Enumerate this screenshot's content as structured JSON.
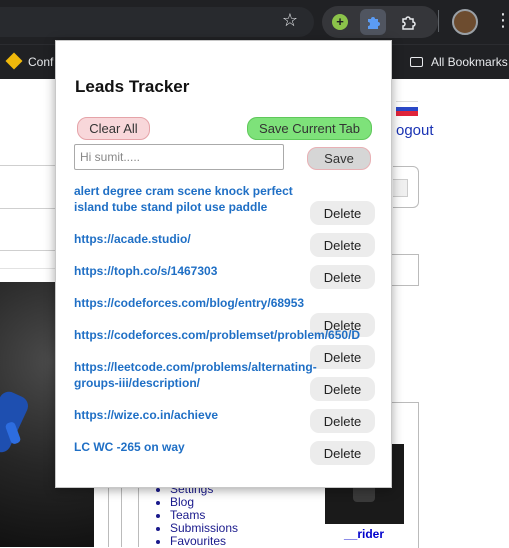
{
  "browser": {
    "bookmarks": [
      {
        "label": "Conf"
      },
      {
        "label": "All Bookmarks"
      }
    ]
  },
  "background_page": {
    "logout_text": "ogout",
    "profile_name": "__rider",
    "menu_items": [
      "Settings",
      "Blog",
      "Teams",
      "Submissions",
      "Favourites"
    ]
  },
  "popup": {
    "title": "Leads Tracker",
    "clear_all_label": "Clear All",
    "save_tab_label": "Save Current Tab",
    "input_placeholder": "Hi sumit.....",
    "save_label": "Save",
    "delete_label": "Delete",
    "leads": [
      "alert degree cram scene knock perfect island tube stand pilot use paddle",
      "https://acade.studio/",
      "https://toph.co/s/1467303",
      "https://codeforces.com/blog/entry/68953",
      "https://codeforces.com/problemset/problem/650/D",
      "https://leetcode.com/problems/alternating-groups-iii/description/",
      "https://wize.co.in/achieve",
      "LC WC -265 on way"
    ]
  },
  "colors": {
    "clear_button": "#f8d7da",
    "save_tab_button": "#7ee27a",
    "link": "#1f6fc5"
  }
}
